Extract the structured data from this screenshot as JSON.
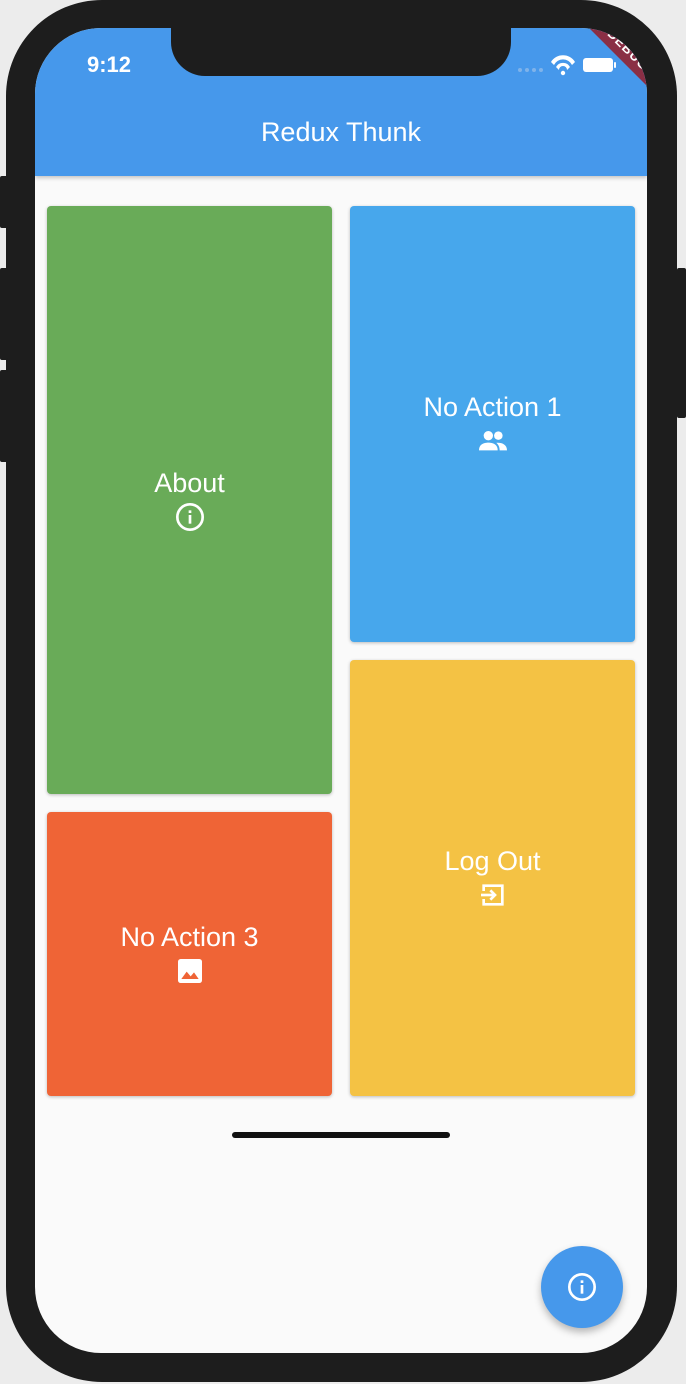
{
  "status_bar": {
    "time": "9:12"
  },
  "debug_banner": {
    "label": "DEBUG"
  },
  "app_bar": {
    "title": "Redux Thunk"
  },
  "tiles": [
    {
      "label": "About",
      "icon": "info-icon",
      "color": "#69ab58"
    },
    {
      "label": "No Action 1",
      "icon": "people-icon",
      "color": "#47a7ec"
    },
    {
      "label": "No Action 3",
      "icon": "image-icon",
      "color": "#ef6436"
    },
    {
      "label": "Log Out",
      "icon": "exit-icon",
      "color": "#f4c244"
    }
  ],
  "fab": {
    "icon": "info-icon",
    "color": "#4698eb"
  },
  "colors": {
    "app_bar": "#4698eb",
    "background": "#fafafa"
  }
}
